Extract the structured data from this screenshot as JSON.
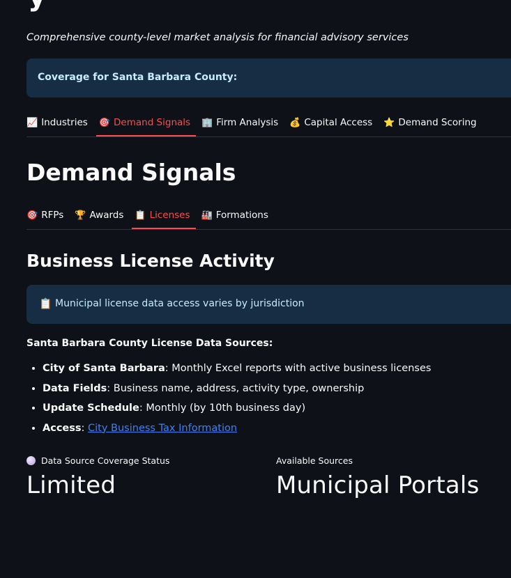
{
  "page": {
    "title_partial": "y",
    "subtitle": "Comprehensive county-level market analysis for financial advisory services"
  },
  "coverage_box": {
    "text": "Coverage for Santa Barbara County:"
  },
  "main_tabs": [
    {
      "icon": "📈",
      "label": "Industries",
      "active": false
    },
    {
      "icon": "🎯",
      "label": "Demand Signals",
      "active": true
    },
    {
      "icon": "🏢",
      "label": "Firm Analysis",
      "active": false
    },
    {
      "icon": "💰",
      "label": "Capital Access",
      "active": false
    },
    {
      "icon": "⭐",
      "label": "Demand Scoring",
      "active": false
    }
  ],
  "section": {
    "heading": "Demand Signals"
  },
  "sub_tabs": [
    {
      "icon": "🎯",
      "label": "RFPs",
      "active": false
    },
    {
      "icon": "🏆",
      "label": "Awards",
      "active": false
    },
    {
      "icon": "📋",
      "label": "Licenses",
      "active": true
    },
    {
      "icon": "🏭",
      "label": "Formations",
      "active": false
    }
  ],
  "license": {
    "heading": "Business License Activity",
    "notice_icon": "📋",
    "notice_text": "Municipal license data access varies by jurisdiction",
    "sources_title": "Santa Barbara County License Data Sources:",
    "items": [
      {
        "key": "City of Santa Barbara",
        "sep": ": ",
        "value": "Monthly Excel reports with active business licenses"
      },
      {
        "key": "Data Fields",
        "sep": ": ",
        "value": "Business name, address, activity type, ownership"
      },
      {
        "key": "Update Schedule",
        "sep": ": ",
        "value": "Monthly (by 10th business day)"
      },
      {
        "key": "Access",
        "sep": ": ",
        "link": "City Business Tax Information"
      }
    ]
  },
  "metrics": [
    {
      "label": "Data Source Coverage Status",
      "value": "Limited",
      "has_dot": true
    },
    {
      "label": "Available Sources",
      "value": "Municipal Portals",
      "has_dot": false
    }
  ],
  "colors": {
    "background": "#0e1117",
    "accent": "#ff4b4b",
    "info_bg": "#172d43",
    "info_text": "#c7ebff",
    "link": "#3b82f6"
  }
}
